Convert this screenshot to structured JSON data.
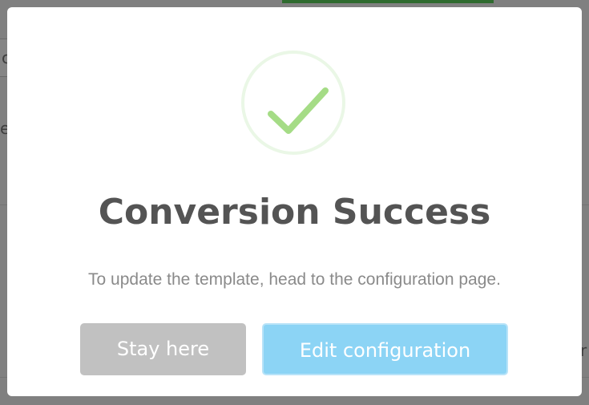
{
  "background": {
    "input_text": "c",
    "label_text_left": "e",
    "label_text_right": "r"
  },
  "modal": {
    "icon": "checkmark-success-icon",
    "title": "Conversion Success",
    "message": "To update the template, head to the configuration page.",
    "buttons": {
      "cancel_label": "Stay here",
      "confirm_label": "Edit configuration"
    },
    "colors": {
      "check": "#a5dc86",
      "check_ring": "#eaf7e6",
      "confirm_button": "#8cd4f5",
      "cancel_button": "#c1c1c1"
    }
  }
}
